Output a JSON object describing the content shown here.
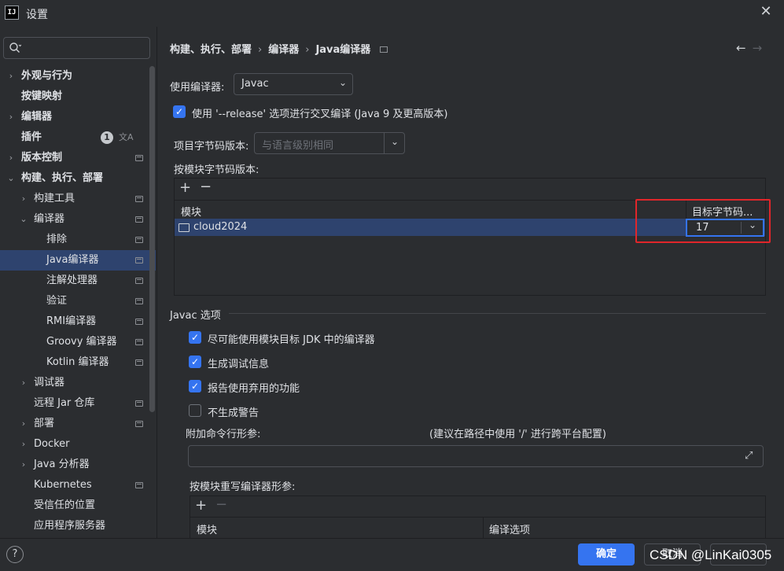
{
  "window": {
    "title": "设置",
    "logo_text": "IJ"
  },
  "search": {
    "placeholder": ""
  },
  "sidebar": {
    "items": [
      {
        "label": "外观与行为"
      },
      {
        "label": "按键映射"
      },
      {
        "label": "编辑器"
      },
      {
        "label": "插件",
        "badge": "1"
      },
      {
        "label": "版本控制"
      },
      {
        "label": "构建、执行、部署"
      },
      {
        "label": "构建工具"
      },
      {
        "label": "编译器"
      },
      {
        "label": "排除"
      },
      {
        "label": "Java编译器"
      },
      {
        "label": "注解处理器"
      },
      {
        "label": "验证"
      },
      {
        "label": "RMI编译器"
      },
      {
        "label": "Groovy 编译器"
      },
      {
        "label": "Kotlin 编译器"
      },
      {
        "label": "调试器"
      },
      {
        "label": "远程 Jar 仓库"
      },
      {
        "label": "部署"
      },
      {
        "label": "Docker"
      },
      {
        "label": "Java 分析器"
      },
      {
        "label": "Kubernetes"
      },
      {
        "label": "受信任的位置"
      },
      {
        "label": "应用程序服务器"
      }
    ]
  },
  "breadcrumb": {
    "part1": "构建、执行、部署",
    "part2": "编译器",
    "part3": "Java编译器"
  },
  "compiler": {
    "use_label": "使用编译器:",
    "use_value": "Javac",
    "release_check_label": "使用 '--release' 选项进行交叉编译 (Java 9 及更高版本)",
    "project_bytecode_label": "项目字节码版本:",
    "project_bytecode_placeholder": "与语言级别相同",
    "per_module_label": "按模块字节码版本:",
    "module_table": {
      "col_module": "模块",
      "col_target": "目标字节码...",
      "rows": [
        {
          "module": "cloud2024",
          "target": "17"
        }
      ]
    }
  },
  "javac": {
    "section_title": "Javac 选项",
    "options": [
      {
        "label": "尽可能使用模块目标 JDK 中的编译器",
        "checked": true
      },
      {
        "label": "生成调试信息",
        "checked": true
      },
      {
        "label": "报告使用弃用的功能",
        "checked": true
      },
      {
        "label": "不生成警告",
        "checked": false
      }
    ],
    "extra_args_label": "附加命令行形参:",
    "extra_args_hint": "(建议在路径中使用 '/' 进行跨平台配置)",
    "override_label": "按模块重写编译器形参:",
    "override_table": {
      "col_module": "模块",
      "col_options": "编译选项"
    }
  },
  "footer": {
    "ok_label": "确定",
    "cancel_label": "取消",
    "apply_label": "",
    "help_label": "?"
  },
  "watermark": {
    "text": "CSDN @LinKai0305"
  },
  "colors": {
    "accent": "#3574f0",
    "highlight_box": "#e0262a",
    "selection": "#2e436e"
  }
}
